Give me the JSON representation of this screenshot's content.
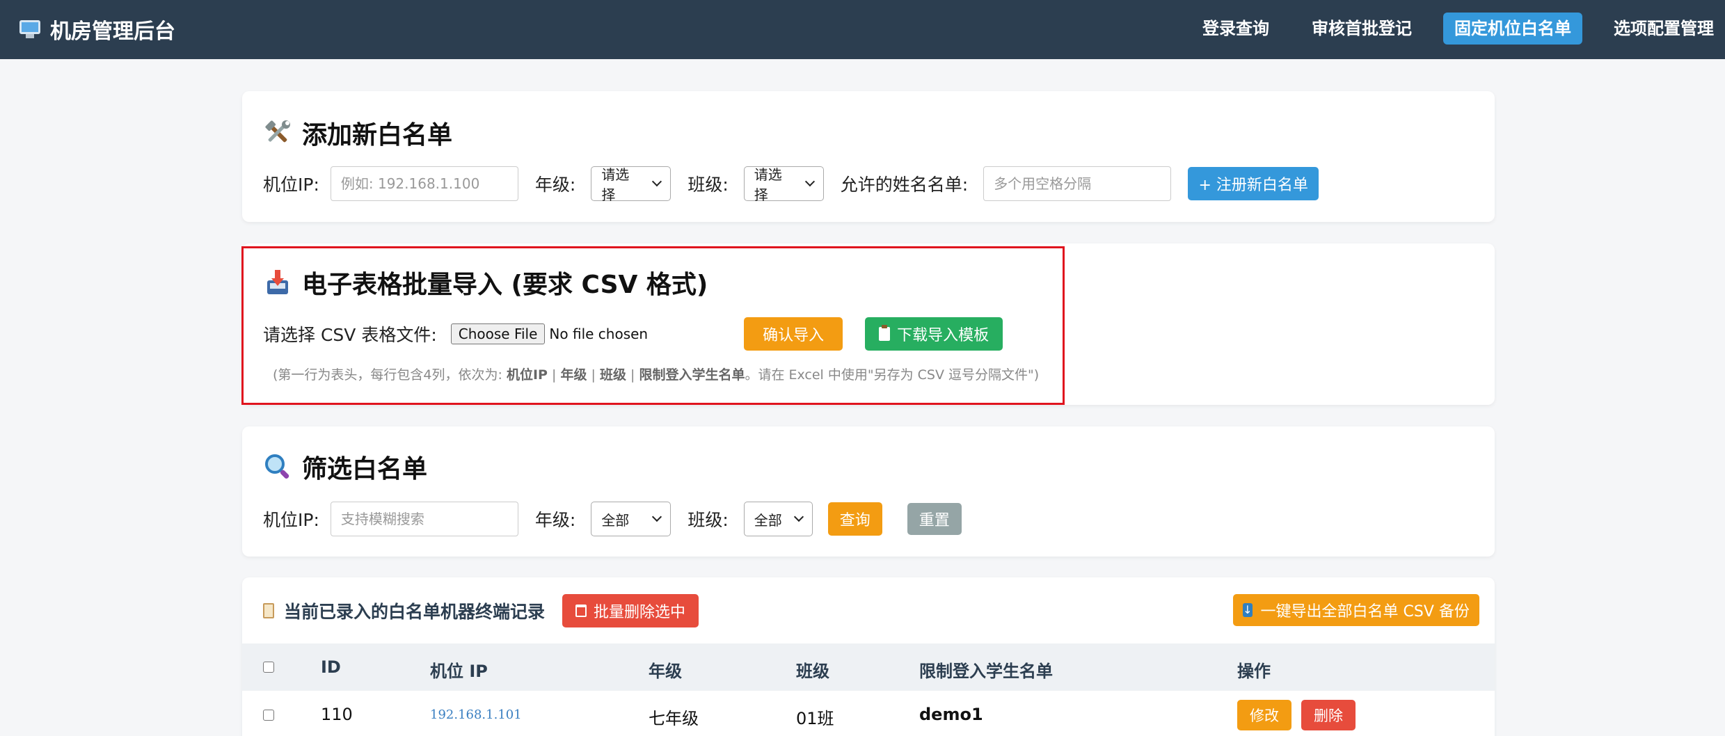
{
  "nav": {
    "brand": "机房管理后台",
    "links": [
      {
        "label": "登录查询",
        "active": false
      },
      {
        "label": "审核首批登记",
        "active": false
      },
      {
        "label": "固定机位白名单",
        "active": true
      },
      {
        "label": "选项配置管理",
        "active": false
      }
    ]
  },
  "add_section": {
    "title": "添加新白名单",
    "ip_label": "机位IP:",
    "ip_placeholder": "例如: 192.168.1.100",
    "grade_label": "年级:",
    "grade_value": "请选择",
    "class_label": "班级:",
    "class_value": "请选择",
    "names_label": "允许的姓名名单:",
    "names_placeholder": "多个用空格分隔",
    "submit_label": "+ 注册新白名单"
  },
  "import_section": {
    "title": "电子表格批量导入 (要求 CSV 格式)",
    "file_label": "请选择 CSV 表格文件:",
    "file_button": "Choose File",
    "file_status": "No file chosen",
    "confirm_label": "确认导入",
    "template_label": "下载导入模板",
    "hint_prefix": "(第一行为表头，每行包含4列，依次为: ",
    "hint_col1": "机位IP",
    "hint_col2": "年级",
    "hint_col3": "班级",
    "hint_col4": "限制登入学生名单",
    "hint_sep": " | ",
    "hint_suffix": "。请在 Excel 中使用\"另存为 CSV 逗号分隔文件\")"
  },
  "filter_section": {
    "title": "筛选白名单",
    "ip_label": "机位IP:",
    "ip_placeholder": "支持模糊搜索",
    "grade_label": "年级:",
    "grade_value": "全部",
    "class_label": "班级:",
    "class_value": "全部",
    "query_label": "查询",
    "reset_label": "重置"
  },
  "table_section": {
    "title": "当前已录入的白名单机器终端记录",
    "batch_delete_label": "批量删除选中",
    "export_label": "一键导出全部白名单 CSV 备份",
    "headers": {
      "id": "ID",
      "ip": "机位 IP",
      "grade": "年级",
      "class": "班级",
      "students": "限制登入学生名单",
      "actions": "操作"
    },
    "rows": [
      {
        "id": "110",
        "ip": "192.168.1.101",
        "grade": "七年级",
        "class": "01班",
        "students": "demo1",
        "edit": "修改",
        "delete": "删除"
      }
    ]
  },
  "colors": {
    "nav_bg": "#2c3e50",
    "accent_blue": "#3498db",
    "orange": "#f39c12",
    "green": "#27ae60",
    "red": "#e74c3c",
    "gray": "#95a5a6"
  }
}
